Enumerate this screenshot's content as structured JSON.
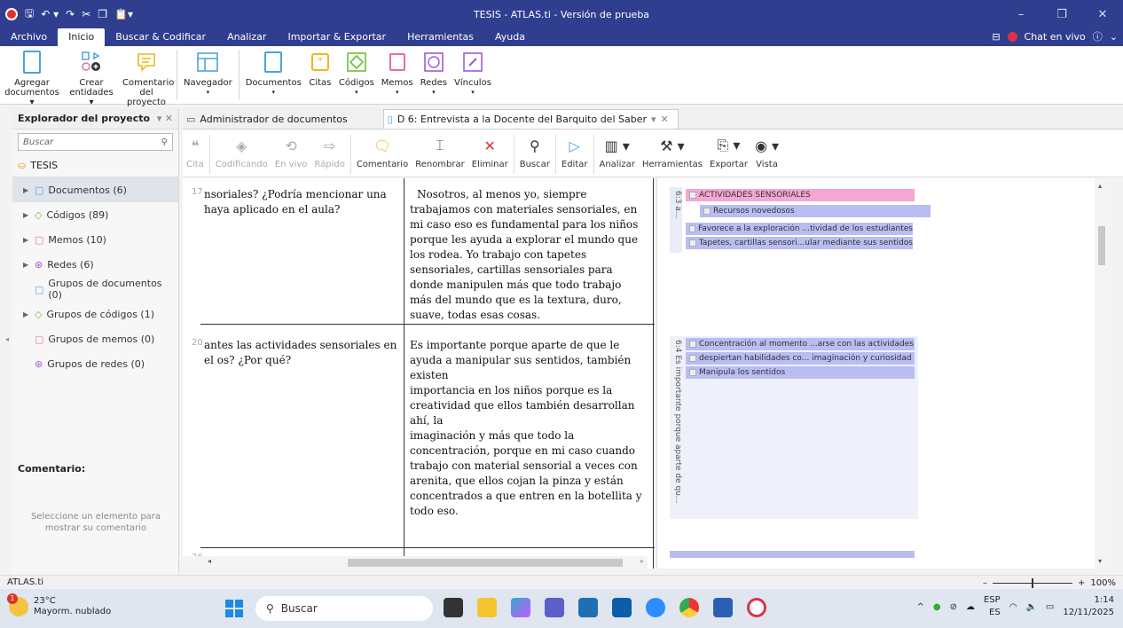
{
  "window": {
    "title": "TESIS - ATLAS.ti - Versión de prueba",
    "controls": [
      "–",
      "❐",
      "✕"
    ]
  },
  "ribbon_tabs": {
    "items": [
      "Archivo",
      "Inicio",
      "Buscar & Codificar",
      "Analizar",
      "Importar & Exportar",
      "Herramientas",
      "Ayuda"
    ],
    "chat_label": "Chat en vivo"
  },
  "ribbon": {
    "agregar": "Agregar documentos ▾",
    "crear": "Crear entidades ▾",
    "comentario": "Comentario del proyecto",
    "navegador": "Navegador",
    "documentos": "Documentos",
    "citas": "Citas",
    "codigos": "Códigos",
    "memos": "Memos",
    "redes": "Redes",
    "vinculos": "Vínculos"
  },
  "explorer": {
    "title": "Explorador del proyecto",
    "search_placeholder": "Buscar",
    "root": "TESIS",
    "items": [
      {
        "label": "Documentos (6)"
      },
      {
        "label": "Códigos (89)"
      },
      {
        "label": "Memos (10)"
      },
      {
        "label": "Redes (6)"
      },
      {
        "label": "Grupos de documentos (0)"
      },
      {
        "label": "Grupos de códigos (1)"
      },
      {
        "label": "Grupos de memos (0)"
      },
      {
        "label": "Grupos de redes (0)"
      }
    ],
    "comment_label": "Comentario:",
    "comment_hint": "Seleccione un elemento para mostrar su comentario"
  },
  "doc_tabs": {
    "tab1": "Administrador de documentos",
    "tab2": "D 6: Entrevista a la Docente del Barquito del Saber"
  },
  "doc_toolbar": {
    "cita": "Cita",
    "codificando": "Codificando",
    "envivo": "En vivo",
    "rapido": "Rápido",
    "comentario": "Comentario",
    "renombrar": "Renombrar",
    "eliminar": "Eliminar",
    "buscar": "Buscar",
    "editar": "Editar",
    "analizar": "Analizar",
    "herramientas": "Herramientas",
    "exportar": "Exportar",
    "vista": "Vista"
  },
  "document": {
    "rows": [
      {
        "line": "17",
        "question": "nsoriales? ¿Podría mencionar una haya aplicado en el aula?",
        "answer": "Nosotros, al menos yo, siempre trabajamos con materiales sensoriales, en mi caso eso es fundamental para los niños porque les ayuda a explorar el mundo que los rodea. Yo trabajo con tapetes sensoriales, cartillas sensoriales para donde manipulen más que todo trabajo más del mundo que es la textura, duro, suave, todas esas cosas."
      },
      {
        "line": "20",
        "question": "antes las actividades sensoriales en el os? ¿Por qué?",
        "answer": "Es importante porque aparte de que le ayuda a manipular sus sentidos, también existen\n importancia en los niños porque es la creatividad que ellos también desarrollan ahí, la\n imaginación y más que todo la concentración, porque en mi caso cuando trabajo con material sensorial a veces con arenita, que ellos cojan la pinza y están concentrados a que entren en la botellita y todo eso."
      },
      {
        "line": "26",
        "question": "",
        "answer": ""
      }
    ]
  },
  "margin": {
    "quote1_label": "6:3 a...",
    "quote2_label": "6:4 Es importante porque aparte de qu...",
    "codes_row1": [
      {
        "label": "ACTIVIDADES SENSORIALES",
        "color": "#f6a6d2"
      },
      {
        "label": "Recursos novedosos",
        "color": "#b9bdf2"
      },
      {
        "label": "Favorece a la exploración ...tividad de los estudiantes",
        "color": "#b9bdf2"
      },
      {
        "label": "Tapetes, cartillas sensori...ular mediante sus sentidos",
        "color": "#b9bdf2"
      }
    ],
    "codes_row2": [
      {
        "label": "Concentración al momento ...arse con las actividades",
        "color": "#b9bdf2"
      },
      {
        "label": "despiertan habilidades co... imaginación y curiosidad",
        "color": "#b9bdf2"
      },
      {
        "label": "Manipula los sentidos",
        "color": "#b9bdf2"
      }
    ]
  },
  "status": {
    "app": "ATLAS.ti",
    "zoom": "100%"
  },
  "taskbar": {
    "temp": "23°C",
    "weather": "Mayorm. nublado",
    "search": "Buscar",
    "lang1": "ESP",
    "lang2": "ES",
    "time": "1:14",
    "date": "12/11/2025",
    "badge": "1"
  },
  "colors": {
    "titlebar": "#2f3e8e",
    "accent_blue": "#4aa3df",
    "code_pink": "#f6a6d2",
    "code_lavender": "#b9bdf2"
  }
}
